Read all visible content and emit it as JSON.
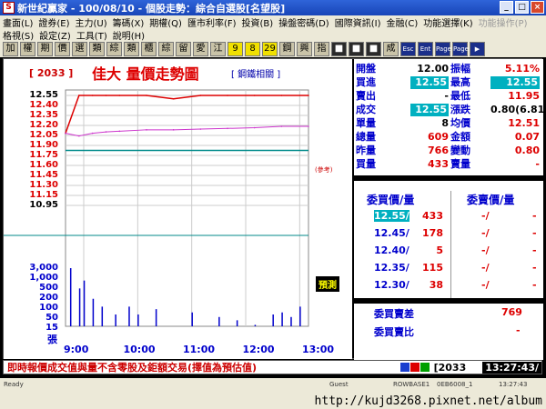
{
  "window": {
    "icon": "S",
    "title": "新世紀贏家 - 100/08/10 - 個股走勢：綜合自選股[名望股]",
    "buttons": [
      "_",
      "□",
      "×"
    ]
  },
  "menu": {
    "row1": [
      {
        "label": "畫面(L)",
        "enabled": true
      },
      {
        "label": "證券(E)",
        "enabled": true
      },
      {
        "label": "主力(U)",
        "enabled": true
      },
      {
        "label": "籌碼(X)",
        "enabled": true
      },
      {
        "label": "期權(Q)",
        "enabled": true
      },
      {
        "label": "匯市利率(F)",
        "enabled": true
      },
      {
        "label": "投資(B)",
        "enabled": true
      },
      {
        "label": "操盤密碼(D)",
        "enabled": true
      },
      {
        "label": "國際資訊(I)",
        "enabled": true
      },
      {
        "label": "金融(C)",
        "enabled": true
      },
      {
        "label": "功能選擇(K)",
        "enabled": true
      },
      {
        "label": "功能操作(P)",
        "enabled": false
      }
    ],
    "row2": [
      {
        "label": "格視(S)",
        "enabled": true
      },
      {
        "label": "設定(Z)",
        "enabled": true
      },
      {
        "label": "工具(T)",
        "enabled": true
      },
      {
        "label": "說明(H)",
        "enabled": true
      }
    ]
  },
  "toolbar": {
    "buttons": [
      {
        "label": "加",
        "style": "normal"
      },
      {
        "label": "權",
        "style": "normal"
      },
      {
        "label": "期",
        "style": "normal"
      },
      {
        "label": "價",
        "style": "normal"
      },
      {
        "label": "選",
        "style": "normal"
      },
      {
        "label": "類",
        "style": "normal"
      },
      {
        "label": "綜",
        "style": "normal"
      },
      {
        "label": "類",
        "style": "normal"
      },
      {
        "label": "櫃",
        "style": "normal"
      },
      {
        "label": "綜",
        "style": "normal"
      },
      {
        "label": "留",
        "style": "normal"
      },
      {
        "label": "愛",
        "style": "normal"
      },
      {
        "label": "江",
        "style": "normal"
      },
      {
        "label": "9",
        "style": "yel"
      },
      {
        "label": "8",
        "style": "yel"
      },
      {
        "label": "29",
        "style": "yel"
      },
      {
        "label": "鋼",
        "style": "normal"
      },
      {
        "label": "興",
        "style": "normal"
      },
      {
        "label": "指",
        "style": "normal"
      },
      {
        "label": "■",
        "style": "dark"
      },
      {
        "label": "■",
        "style": "dark"
      },
      {
        "label": "■",
        "style": "dark"
      },
      {
        "label": "成",
        "style": "normal"
      },
      {
        "label": "Esc",
        "style": "blu"
      },
      {
        "label": "Ent",
        "style": "blu"
      },
      {
        "label": "Page",
        "style": "blu"
      },
      {
        "label": "Page",
        "style": "blu"
      },
      {
        "label": "▶",
        "style": "blu"
      }
    ]
  },
  "chart": {
    "code": "[ 2033 ]",
    "title": "佳大  量價走勢圖",
    "sector_link": "[ 鋼鐵相關 ]",
    "ref_label": "(參考)",
    "panel_button": "預測",
    "vol_unit": "張",
    "price_ticks": [
      {
        "label": "12.55",
        "color": "blk"
      },
      {
        "label": "12.40",
        "color": "red"
      },
      {
        "label": "12.35",
        "color": "red"
      },
      {
        "label": "12.20",
        "color": "red"
      },
      {
        "label": "12.05",
        "color": "red"
      },
      {
        "label": "11.90",
        "color": "red"
      },
      {
        "label": "11.75",
        "color": "red"
      },
      {
        "label": "11.60",
        "color": "red"
      },
      {
        "label": "11.45",
        "color": "red"
      },
      {
        "label": "11.30",
        "color": "red"
      },
      {
        "label": "11.15",
        "color": "red"
      },
      {
        "label": "10.95",
        "color": "blk"
      }
    ],
    "vol_ticks": [
      "3,000",
      "1,000",
      "500",
      "200",
      "100",
      "50",
      "15"
    ],
    "time_ticks": [
      "9:00",
      "10:00",
      "11:00",
      "12:00",
      "13:00"
    ],
    "colors": {
      "price": "#dd0000",
      "avg": "#cc33cc",
      "vol": "#0000cc",
      "ref": "#008a8a",
      "grid": "#cccccc"
    }
  },
  "chart_data": {
    "type": "line",
    "title": "佳大  量價走勢圖",
    "x": [
      "9:00",
      "9:15",
      "9:30",
      "9:45",
      "10:00",
      "10:30",
      "11:00",
      "11:30",
      "12:00",
      "12:30",
      "13:00",
      "13:30"
    ],
    "series": [
      {
        "values": [
          12.0,
          12.55,
          12.55,
          12.55,
          12.55,
          12.55,
          12.5,
          12.55,
          12.55,
          12.55,
          12.55,
          12.55
        ]
      },
      {
        "values": [
          12.0,
          11.96,
          12.0,
          12.02,
          12.03,
          12.05,
          12.05,
          12.06,
          12.07,
          12.08,
          12.1,
          12.1
        ]
      }
    ],
    "reference_price": 11.75,
    "ylim": [
      10.95,
      12.55
    ],
    "volume": {
      "times": [
        "9:05",
        "9:15",
        "9:20",
        "9:30",
        "9:40",
        "9:55",
        "10:10",
        "10:20",
        "10:40",
        "11:00",
        "11:20",
        "11:50",
        "12:10",
        "12:30",
        "12:50",
        "13:00",
        "13:10",
        "13:20"
      ],
      "values": [
        3000,
        500,
        1000,
        200,
        100,
        50,
        100,
        50,
        80,
        15,
        60,
        40,
        30,
        20,
        50,
        60,
        40,
        100
      ]
    }
  },
  "quote": {
    "rows": [
      {
        "l1": "開盤",
        "v1": "12.00",
        "c1": "black",
        "l2": "振幅",
        "v2": "5.11%",
        "c2": "red"
      },
      {
        "l1": "買進",
        "v1": "12.55",
        "c1": "box",
        "l2": "最高",
        "v2": "12.55",
        "c2": "box"
      },
      {
        "l1": "賣出",
        "v1": "-",
        "c1": "black",
        "l2": "最低",
        "v2": "11.95",
        "c2": "red"
      },
      {
        "l1": "成交",
        "v1": "12.55",
        "c1": "box",
        "l2": "漲跌",
        "v2": "0.80(6.81)",
        "c2": "black"
      },
      {
        "l1": "單量",
        "v1": "8",
        "c1": "black",
        "l2": "均價",
        "v2": "12.51",
        "c2": "red"
      },
      {
        "l1": "總量",
        "v1": "609",
        "c1": "red",
        "l2": "金額",
        "v2": "0.07",
        "c2": "red"
      },
      {
        "l1": "昨量",
        "v1": "766",
        "c1": "red",
        "l2": "變動",
        "v2": "0.80",
        "c2": "red"
      },
      {
        "l1": "買量",
        "v1": "433",
        "c1": "red",
        "l2": "賣量",
        "v2": "-",
        "c2": "red"
      }
    ]
  },
  "orderbook": {
    "bid_header": "委買價/量",
    "ask_header": "委賣價/量",
    "rows": [
      {
        "bp": "12.55/",
        "bq": "433",
        "ap": "-/",
        "aq": "-",
        "highlight": true
      },
      {
        "bp": "12.45/",
        "bq": "178",
        "ap": "-/",
        "aq": "-",
        "highlight": false
      },
      {
        "bp": "12.40/",
        "bq": "5",
        "ap": "-/",
        "aq": "-",
        "highlight": false
      },
      {
        "bp": "12.35/",
        "bq": "115",
        "ap": "-/",
        "aq": "-",
        "highlight": false
      },
      {
        "bp": "12.30/",
        "bq": "38",
        "ap": "-/",
        "aq": "-",
        "highlight": false
      }
    ],
    "spread_label": "委買賣差",
    "spread_value": "769",
    "ratio_label": "委買賣比",
    "ratio_value": "-"
  },
  "status": {
    "message": "即時報價成交值與量不含零股及鉅額交易(擇值為預估值)",
    "code": "[2033",
    "time": "13:27:43/"
  },
  "sysbar": {
    "items": [
      "Ready",
      "Guest",
      "ROWBASE1",
      "0EB6008_1",
      "13:27:43"
    ],
    "watermark": "http://kujd3268.pixnet.net/album"
  }
}
